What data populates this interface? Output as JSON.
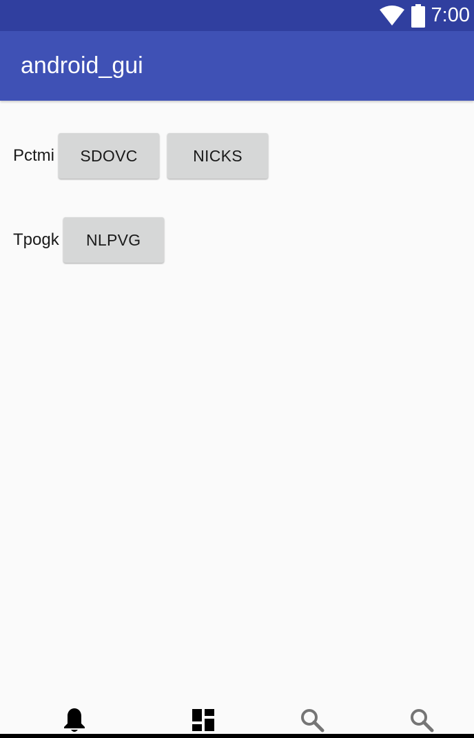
{
  "status_bar": {
    "time": "7:00",
    "icons": [
      "wifi-icon",
      "battery-icon"
    ]
  },
  "app_bar": {
    "title": "android_gui"
  },
  "rows": [
    {
      "label": "Pctmi",
      "buttons": [
        "SDOVC",
        "NICKS"
      ]
    },
    {
      "label": "Tpogk",
      "buttons": [
        "NLPVG"
      ]
    }
  ],
  "bottom_nav": {
    "items": [
      "bell-icon",
      "dashboard-icon",
      "search-icon",
      "search-icon"
    ]
  },
  "colors": {
    "status_bar": "#303f9f",
    "app_bar": "#3f51b5",
    "background": "#fafafa",
    "button": "#d6d7d7",
    "inactive_icon": "#757575"
  }
}
